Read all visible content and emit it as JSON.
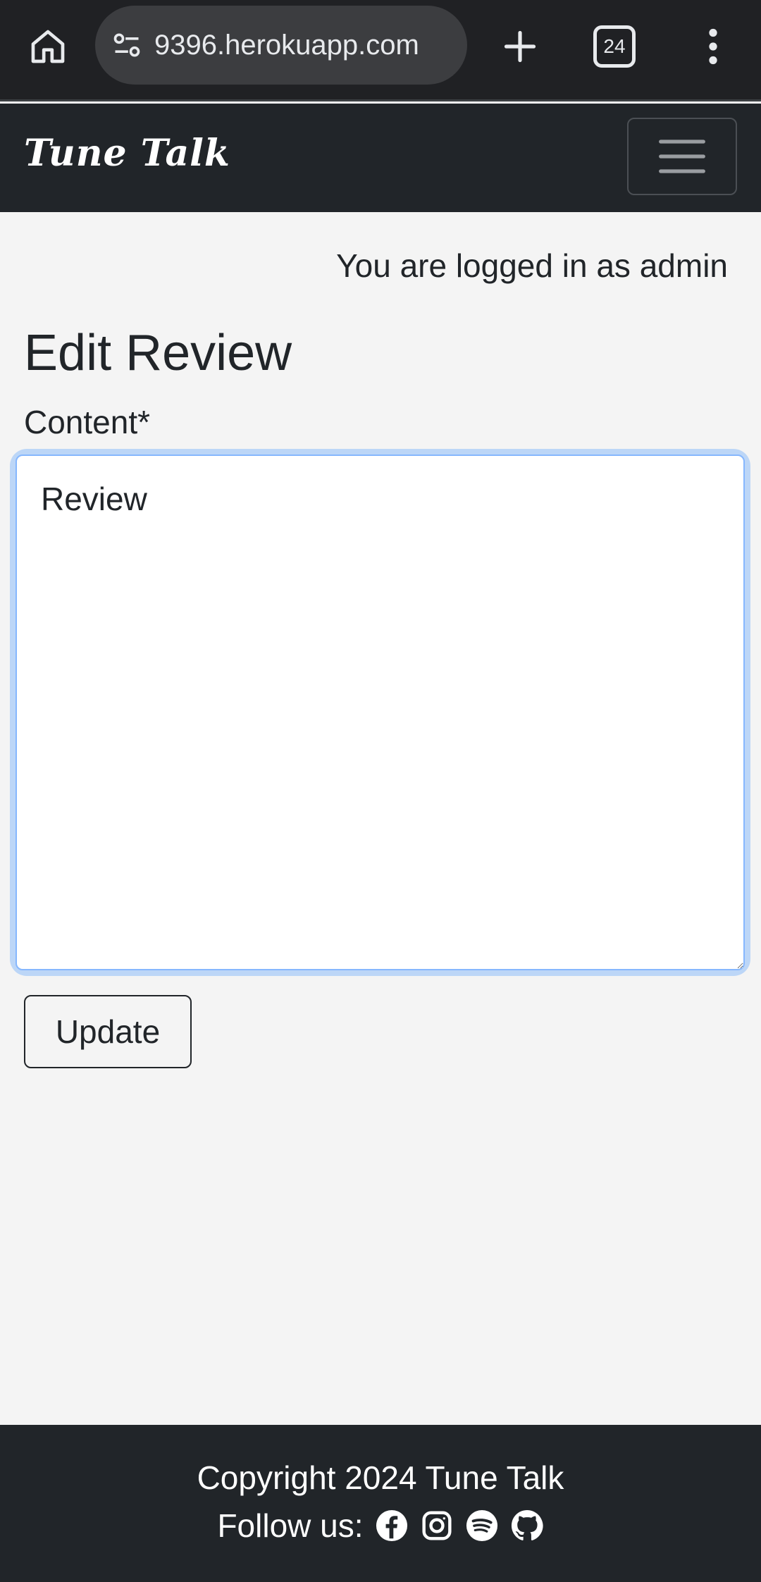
{
  "browser": {
    "url": "9396.herokuapp.com",
    "tab_count": "24",
    "icons": [
      "home-icon",
      "site-settings-icon",
      "plus-icon",
      "tab-switcher-icon",
      "more-vert-icon"
    ]
  },
  "navbar": {
    "brand": "Tune Talk",
    "toggler_icon": "hamburger-menu-icon"
  },
  "main": {
    "login_status": "You are logged in as admin",
    "title": "Edit Review",
    "content_label": "Content*",
    "content_value": "Review ",
    "update_label": "Update"
  },
  "footer": {
    "copyright": "Copyright 2024 Tune Talk",
    "follow_label": "Follow us:",
    "social_icons": [
      "facebook-icon",
      "instagram-icon",
      "spotify-icon",
      "github-icon"
    ]
  },
  "colors": {
    "navbar_bg": "#212529",
    "page_bg": "#f4f4f4",
    "focus_ring": "#bcd6f7",
    "browser_bg": "#202124"
  }
}
